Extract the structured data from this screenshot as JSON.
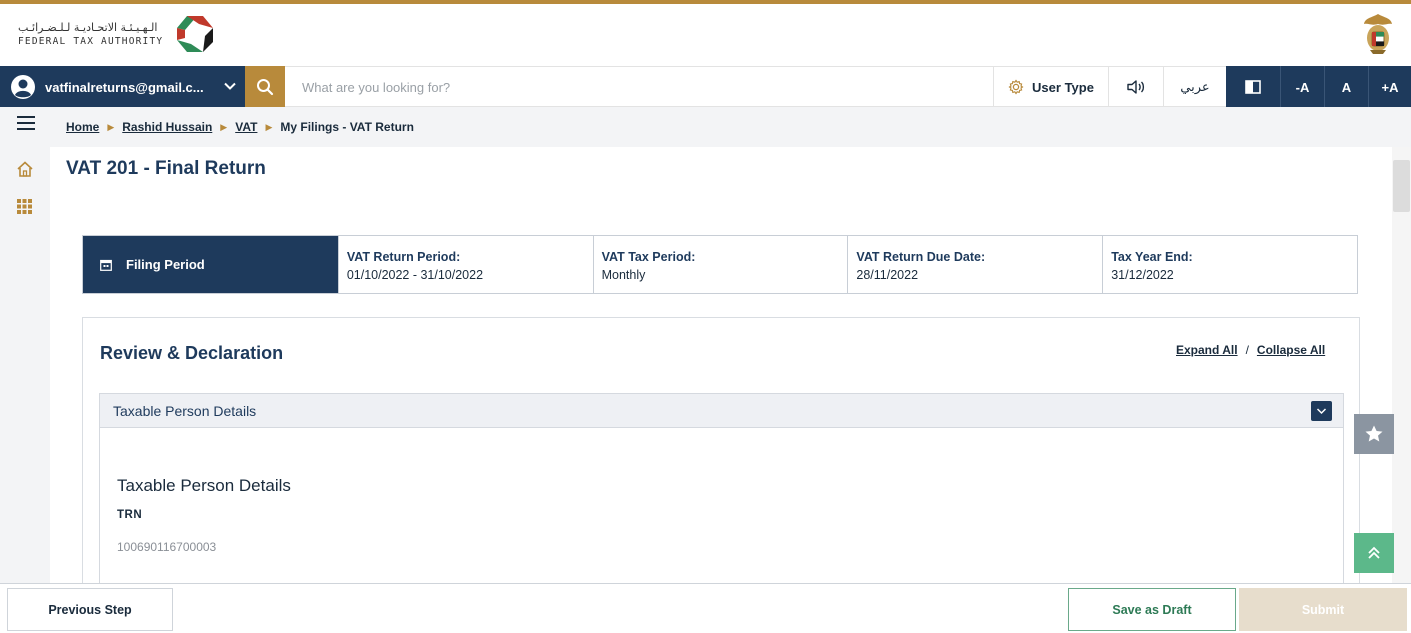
{
  "header": {
    "logo_ar": "الـهـيـئـة الاتحـاديـة لـلـضـرائـب",
    "logo_en": "FEDERAL TAX AUTHORITY"
  },
  "navbar": {
    "user_email": "vatfinalreturns@gmail.c...",
    "search_placeholder": "What are you looking for?",
    "user_type_label": "User Type",
    "language_label": "عربي",
    "font_decrease": "-A",
    "font_normal": "A",
    "font_increase": "+A"
  },
  "breadcrumb": {
    "items": [
      "Home",
      "Rashid Hussain",
      "VAT"
    ],
    "current": "My Filings - VAT Return"
  },
  "page": {
    "title": "VAT 201 - Final Return"
  },
  "filing_period": {
    "heading": "Filing Period",
    "fields": [
      {
        "label": "VAT Return Period:",
        "value": "01/10/2022 - 31/10/2022"
      },
      {
        "label": "VAT Tax Period:",
        "value": "Monthly"
      },
      {
        "label": "VAT Return Due Date:",
        "value": "28/11/2022"
      },
      {
        "label": "Tax Year End:",
        "value": "31/12/2022"
      }
    ]
  },
  "review": {
    "title": "Review & Declaration",
    "expand_all": "Expand All",
    "separator": "/",
    "collapse_all": "Collapse All",
    "accordion_title": "Taxable Person Details",
    "section_title": "Taxable Person Details",
    "trn_label": "TRN",
    "trn_value": "100690116700003"
  },
  "footer": {
    "previous_label": "Previous Step",
    "draft_label": "Save as Draft",
    "submit_label": "Submit"
  },
  "colors": {
    "navy": "#1e3a5c",
    "gold": "#b88a3b",
    "green": "#5cb88a",
    "submit_disabled": "#e7ddcc"
  },
  "icons": {
    "search": "search-icon",
    "user_type": "gear-icon",
    "sound": "speaker-icon",
    "contrast": "contrast-icon",
    "menu": "hamburger-icon",
    "home": "home-icon",
    "apps": "grid-icon",
    "favorite": "star-icon",
    "back_to_top": "double-chevron-up-icon"
  }
}
